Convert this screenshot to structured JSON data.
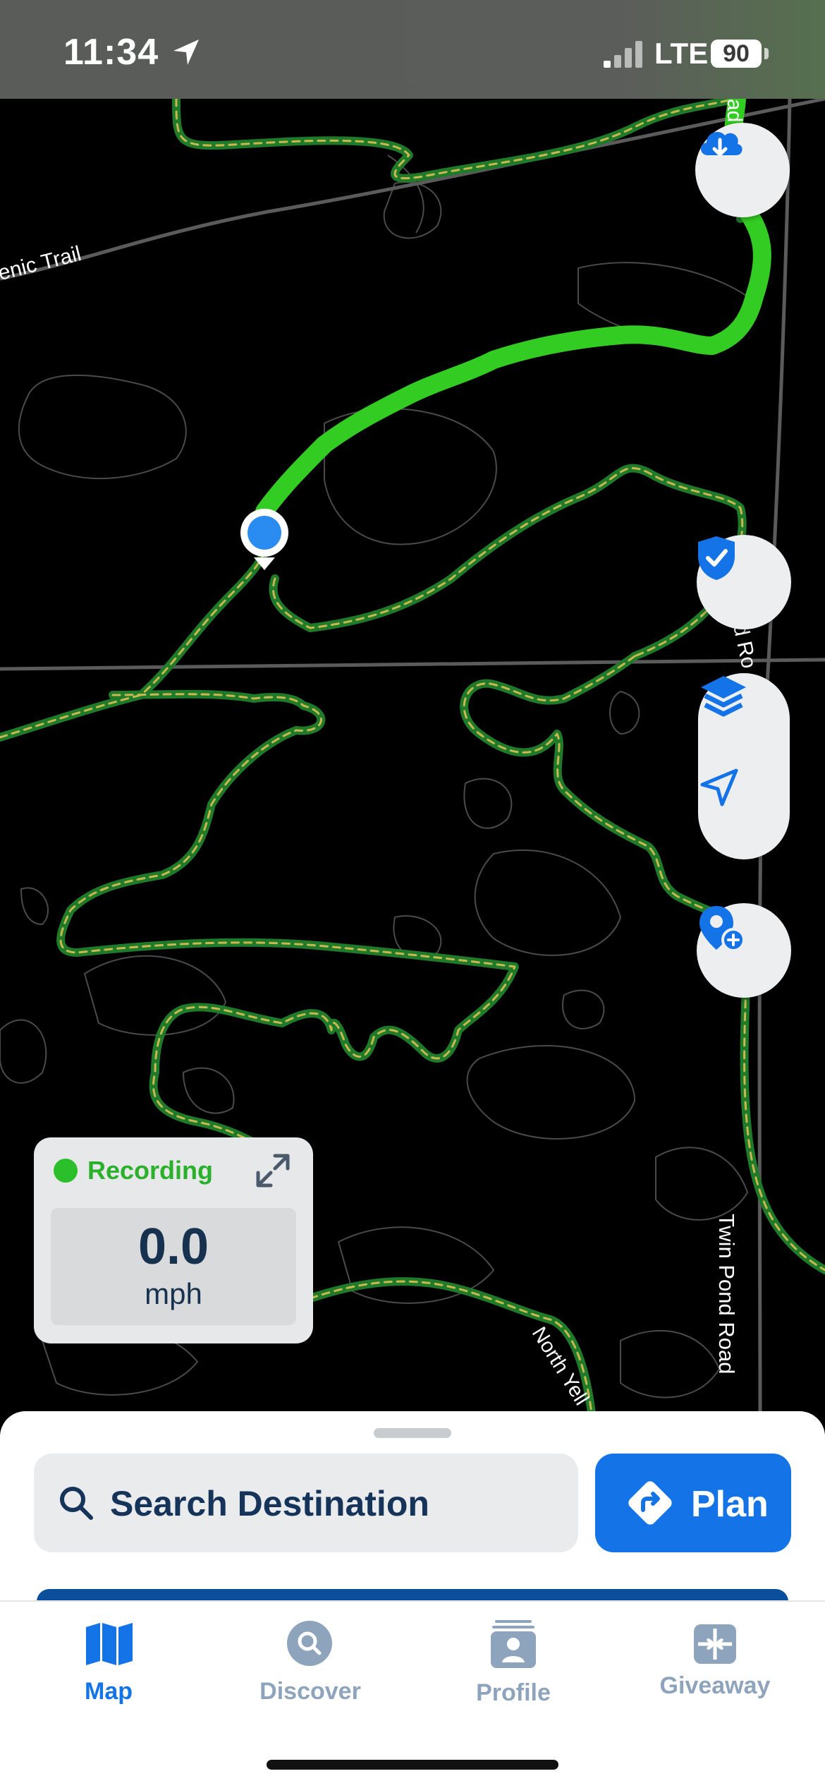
{
  "status_bar": {
    "time": "11:34",
    "network": "LTE",
    "battery": "90"
  },
  "map": {
    "labels": {
      "scenic_trail": "enic Trail",
      "twin_pond_road": "Twin Pond Road",
      "pond_road_partial": "nd Ro",
      "road_top_partial": "ad",
      "north_partial": "North Yell"
    },
    "buttons": {
      "offline_download": "cloud-download-icon",
      "safety": "shield-check-icon",
      "layers": "layers-icon",
      "locate": "navigation-arrow-icon",
      "add_pin": "add-pin-icon"
    },
    "colors": {
      "route_highlight": "#33cc22",
      "trail_outline": "#1f7a2a",
      "trail_dash": "#d8c65a",
      "location_dot": "#2a8cf0"
    }
  },
  "recording": {
    "status": "Recording",
    "speed": "0.0",
    "unit": "mph",
    "status_color": "#2bb02b"
  },
  "sheet": {
    "search_placeholder": "Search Destination",
    "plan_label": "Plan"
  },
  "tabs": [
    {
      "label": "Map",
      "icon": "map-icon",
      "active": true
    },
    {
      "label": "Discover",
      "icon": "discover-icon",
      "active": false
    },
    {
      "label": "Profile",
      "icon": "profile-icon",
      "active": false
    },
    {
      "label": "Giveaway",
      "icon": "gift-icon",
      "active": false
    }
  ]
}
